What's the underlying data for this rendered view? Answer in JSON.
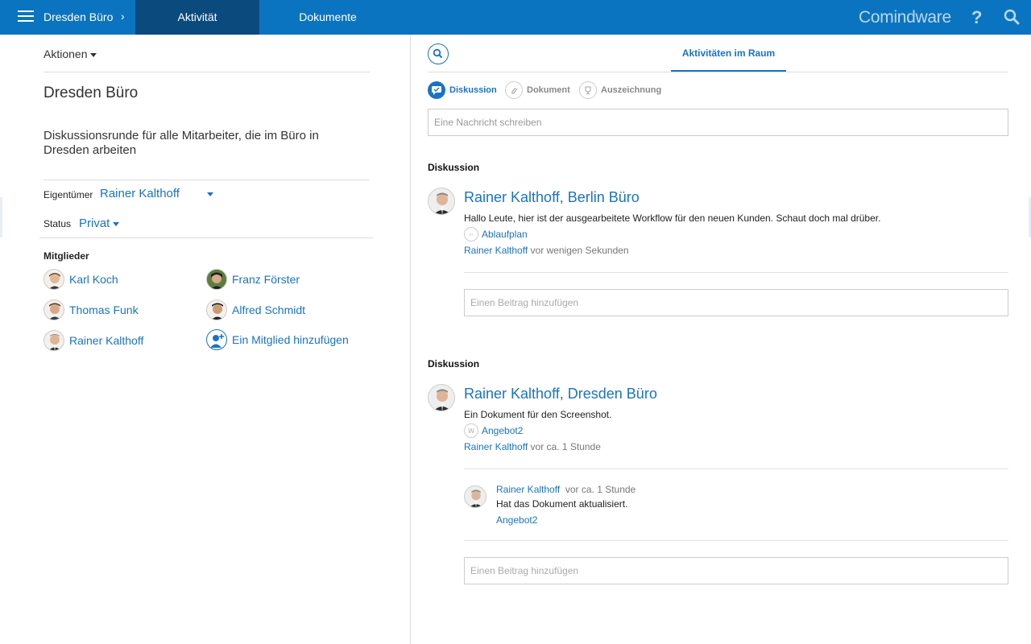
{
  "topbar": {
    "space_title": "Dresden Büro",
    "tabs": [
      {
        "label": "Aktivität",
        "active": true
      },
      {
        "label": "Dokumente",
        "active": false
      }
    ],
    "brand": "Comindware",
    "help": "?"
  },
  "left": {
    "actions_label": "Aktionen",
    "space_name": "Dresden Büro",
    "description": "Diskussionsrunde für alle Mitarbeiter, die im Büro in Dresden arbeiten",
    "owner_label": "Eigentümer",
    "owner_value": "Rainer Kalthoff",
    "status_label": "Status",
    "status_value": "Privat",
    "members_title": "Mitglieder",
    "members": [
      {
        "name": "Karl Koch"
      },
      {
        "name": "Franz Förster"
      },
      {
        "name": "Thomas Funk"
      },
      {
        "name": "Alfred Schmidt"
      },
      {
        "name": "Rainer Kalthoff"
      }
    ],
    "add_member": "Ein Mitglied hinzufügen"
  },
  "right": {
    "tab_label": "Aktivitäten im Raum",
    "post_types": [
      {
        "label": "Diskussion",
        "active": true
      },
      {
        "label": "Dokument",
        "active": false
      },
      {
        "label": "Auszeichnung",
        "active": false
      }
    ],
    "message_placeholder": "Eine Nachricht schreiben",
    "posts": [
      {
        "section": "Diskussion",
        "author": "Rainer Kalthoff",
        "space": "Berlin Büro",
        "text": "Hallo Leute, hier ist der ausgearbeitete Workflow für den neuen Kunden. Schaut doch mal drüber.",
        "attachment": "Ablaufplan",
        "meta_author": "Rainer Kalthoff",
        "meta_time": "vor wenigen Sekunden",
        "reply_placeholder": "Einen Beitrag hinzufügen"
      },
      {
        "section": "Diskussion",
        "author": "Rainer Kalthoff",
        "space": "Dresden Büro",
        "text": "Ein Dokument für den Screenshot.",
        "attachment": "Angebot2",
        "meta_author": "Rainer Kalthoff",
        "meta_time": "vor ca. 1 Stunde",
        "comment": {
          "author": "Rainer Kalthoff",
          "time": "vor ca. 1 Stunde",
          "text": "Hat das Dokument aktualisiert.",
          "link": "Angebot2"
        },
        "reply_placeholder": "Einen Beitrag hinzufügen"
      }
    ]
  },
  "colors": {
    "topbar": "#0b74c0",
    "active_tab": "#0a4a7d",
    "link": "#1a73c2"
  }
}
